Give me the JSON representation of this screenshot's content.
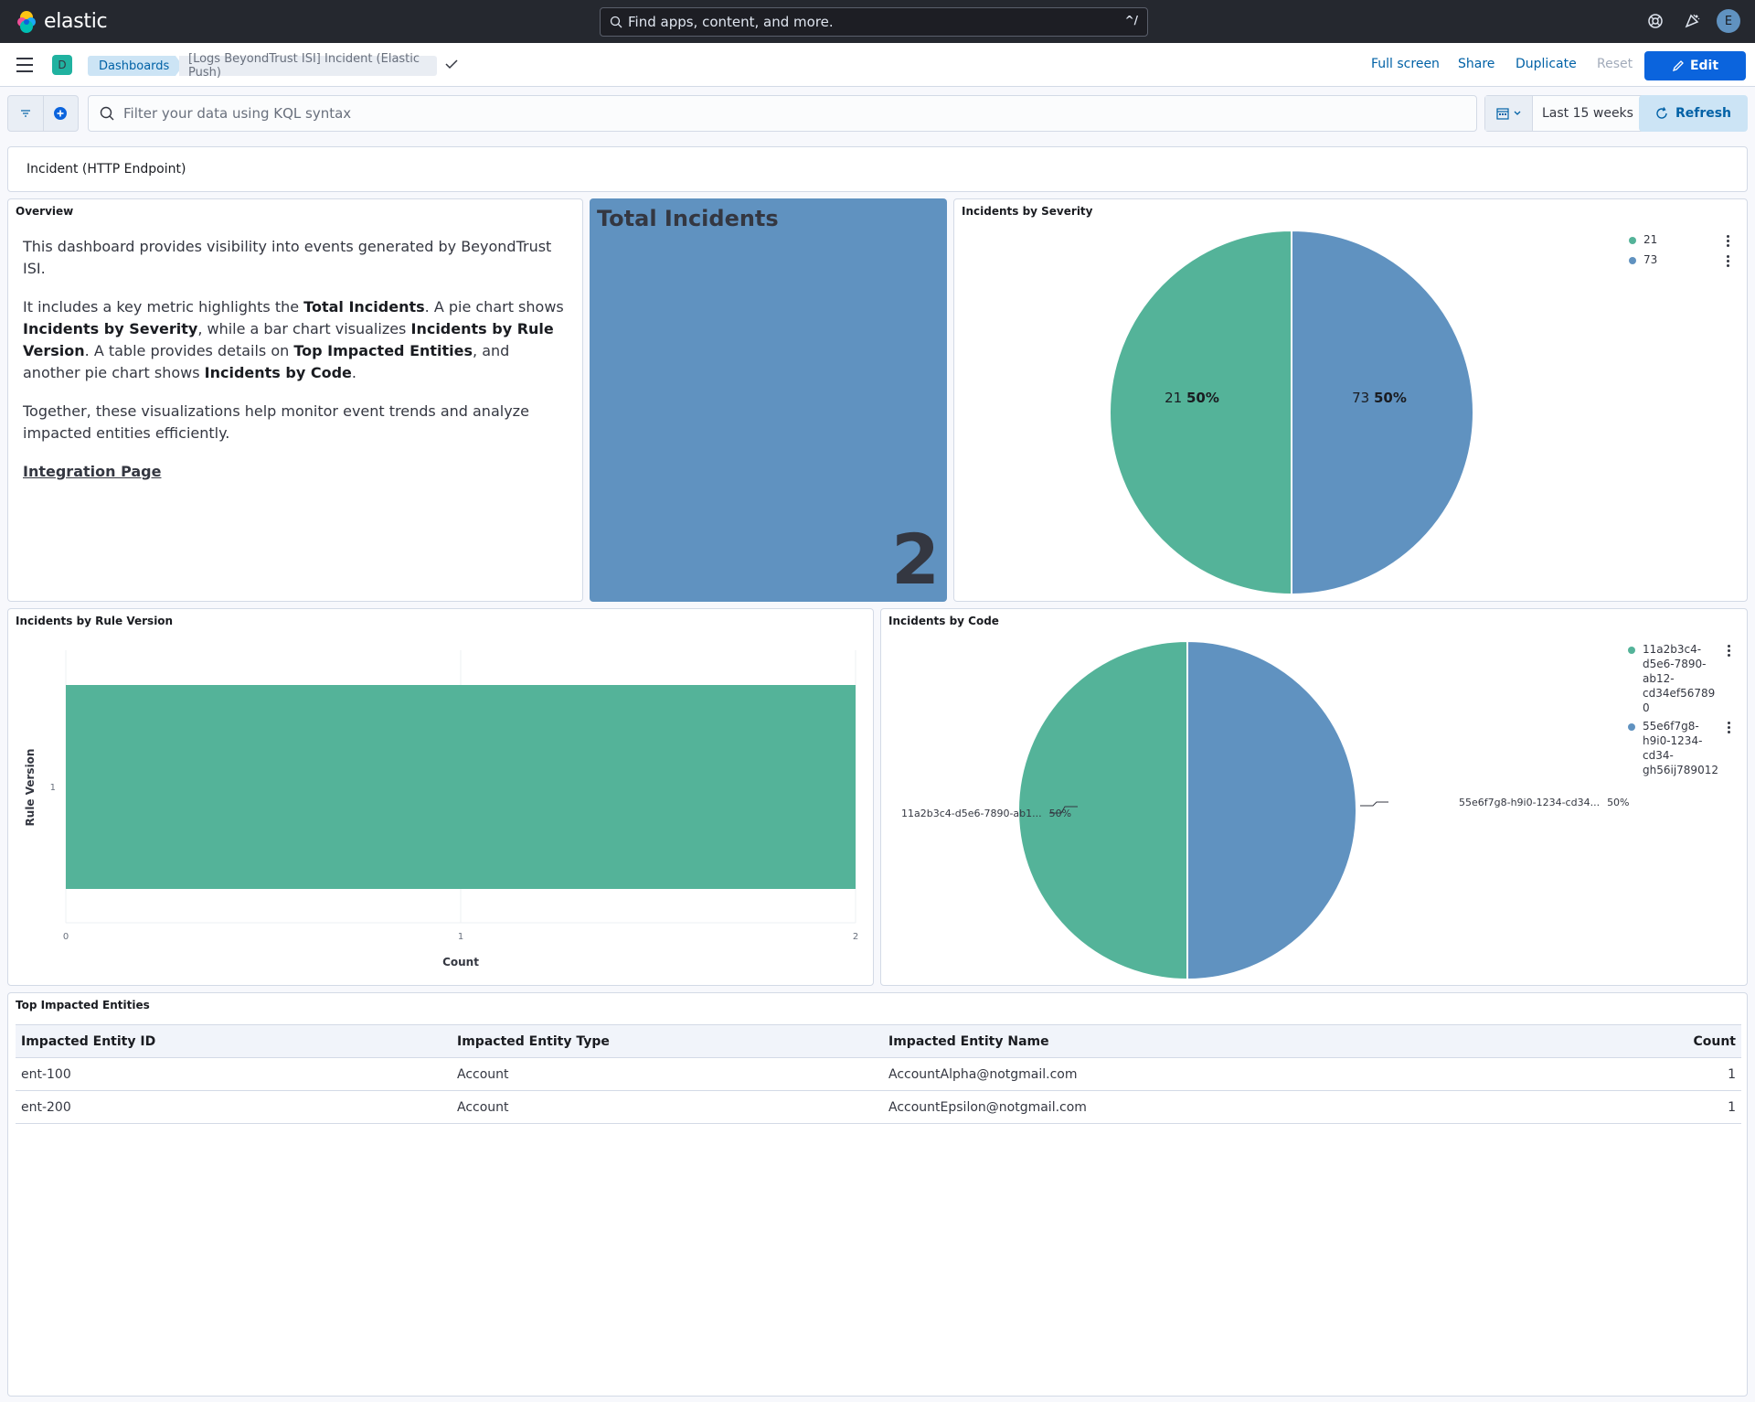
{
  "header": {
    "brand": "elastic",
    "search_placeholder": "Find apps, content, and more.",
    "search_shortcut": "^/",
    "avatar_initial": "E"
  },
  "subheader": {
    "space_initial": "D",
    "breadcrumbs": [
      "Dashboards",
      "[Logs BeyondTrust ISI] Incident (Elastic Push)"
    ],
    "actions": {
      "full_screen": "Full screen",
      "share": "Share",
      "duplicate": "Duplicate",
      "reset": "Reset",
      "edit": "Edit"
    }
  },
  "query": {
    "placeholder": "Filter your data using KQL syntax",
    "time_range": "Last 15 weeks",
    "refresh": "Refresh"
  },
  "section_title": "Incident (HTTP Endpoint)",
  "overview": {
    "title": "Overview",
    "p1": "This dashboard provides visibility into events generated by BeyondTrust ISI.",
    "p2": {
      "t1": "It includes a key metric highlights the ",
      "b1": "Total Incidents",
      "t2": ". A pie chart shows ",
      "b2": "Incidents by Severity",
      "t3": ", while a bar chart visualizes ",
      "b3": "Incidents by Rule Version",
      "t4": ". A table provides details on ",
      "b4": "Top Impacted Entities",
      "t5": ", and another pie chart shows ",
      "b5": "Incidents by Code",
      "t6": "."
    },
    "p3": "Together, these visualizations help monitor event trends and analyze impacted entities efficiently.",
    "link": "Integration Page"
  },
  "metric": {
    "title": "Total Incidents",
    "value": "2"
  },
  "severity_chart": {
    "title": "Incidents by Severity",
    "legend": [
      "21",
      "73"
    ],
    "slice_labels": [
      {
        "name": "21",
        "pct": "50%"
      },
      {
        "name": "73",
        "pct": "50%"
      }
    ]
  },
  "rule_chart": {
    "title": "Incidents by Rule Version",
    "ylabel": "Rule Version",
    "xlabel": "Count",
    "category": "1",
    "x_ticks": [
      "0",
      "1",
      "2"
    ]
  },
  "code_chart": {
    "title": "Incidents by Code",
    "legend": [
      [
        "11a2b3c4-",
        "d5e6-7890-",
        "ab12-",
        "cd34ef56789",
        "0"
      ],
      [
        "55e6f7g8-",
        "h9i0-1234-",
        "cd34-",
        "gh56ij789012"
      ]
    ],
    "callouts": [
      {
        "name": "11a2b3c4-d5e6-7890-ab1...",
        "pct": "50%"
      },
      {
        "name": "55e6f7g8-h9i0-1234-cd34...",
        "pct": "50%"
      }
    ]
  },
  "entities": {
    "title": "Top Impacted Entities",
    "columns": [
      "Impacted Entity ID",
      "Impacted Entity Type",
      "Impacted Entity Name",
      "Count"
    ],
    "rows": [
      [
        "ent-100",
        "Account",
        "AccountAlpha@notgmail.com",
        "1"
      ],
      [
        "ent-200",
        "Account",
        "AccountEpsilon@notgmail.com",
        "1"
      ]
    ]
  },
  "colors": {
    "green": "#54b399",
    "blue": "#6092c0",
    "header_bg": "#25282f",
    "primary": "#0b64dd"
  },
  "chart_data": [
    {
      "type": "pie",
      "title": "Incidents by Severity",
      "categories": [
        "21",
        "73"
      ],
      "values": [
        1,
        1
      ],
      "percent": [
        50,
        50
      ],
      "legend": "top-right"
    },
    {
      "type": "bar",
      "title": "Incidents by Rule Version",
      "orientation": "horizontal",
      "categories": [
        "1"
      ],
      "values": [
        2
      ],
      "xlabel": "Count",
      "ylabel": "Rule Version",
      "xlim": [
        0,
        2
      ]
    },
    {
      "type": "pie",
      "title": "Incidents by Code",
      "categories": [
        "11a2b3c4-d5e6-7890-ab12-cd34ef567890",
        "55e6f7g8-h9i0-1234-cd34-gh56ij789012"
      ],
      "values": [
        1,
        1
      ],
      "percent": [
        50,
        50
      ],
      "legend": "top-right"
    }
  ]
}
